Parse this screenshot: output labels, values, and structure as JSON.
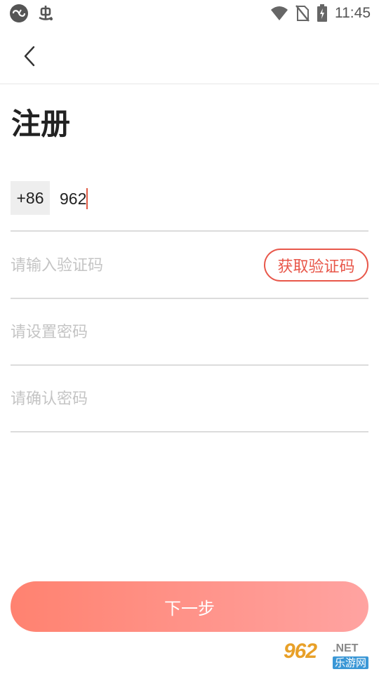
{
  "status_bar": {
    "time": "11:45",
    "icons": [
      "app-circle-icon",
      "bug-icon",
      "wifi-icon",
      "no-sim-icon",
      "battery-charging-icon"
    ]
  },
  "toolbar": {
    "back_icon": "chevron-left-icon"
  },
  "page": {
    "title": "注册"
  },
  "form": {
    "country_code": "+86",
    "phone_value": "962",
    "code_placeholder": "请输入验证码",
    "get_code_label": "获取验证码",
    "password_placeholder": "请设置密码",
    "confirm_placeholder": "请确认密码"
  },
  "actions": {
    "next_label": "下一步"
  },
  "watermark": {
    "number": "962",
    "domain": ".NET",
    "cn": "乐游网"
  },
  "colors": {
    "accent": "#e8574a",
    "button_gradient_start": "#ff8270",
    "button_gradient_end": "#ffa3a1",
    "placeholder": "#c4c4c4"
  }
}
